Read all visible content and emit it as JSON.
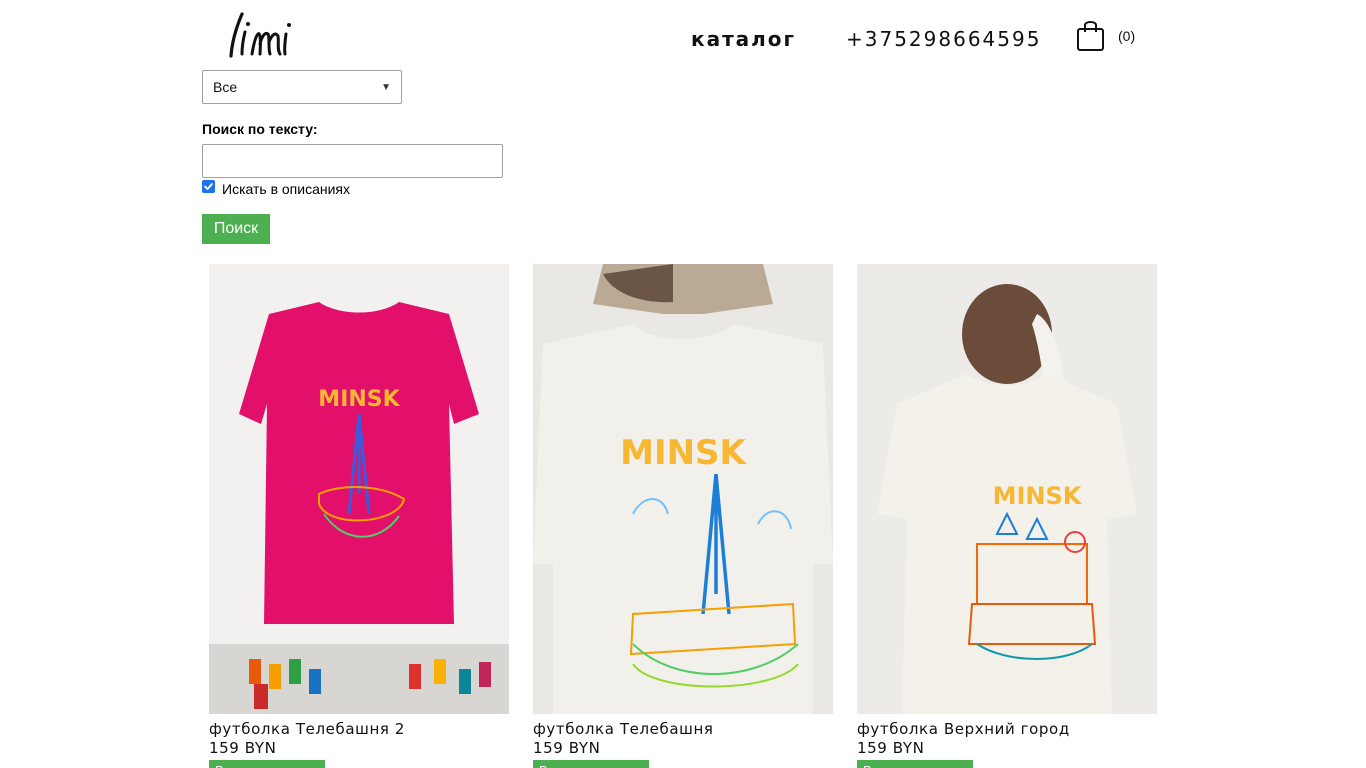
{
  "header": {
    "logo_text": "limi",
    "nav_catalog": "каталог",
    "phone": "+375298664595",
    "cart_count": "(0)"
  },
  "filter": {
    "category_selected": "Все",
    "search_label": "Поиск по тексту:",
    "search_value": "",
    "search_in_descriptions_label": "Искать в описаниях",
    "search_in_descriptions_checked": true,
    "search_button": "Поиск"
  },
  "products": [
    {
      "name": "футболка Телебашня 2",
      "price": "159 BYN",
      "button": "В корзину",
      "shirt_color": "#e3106b",
      "print_text": "MINSK"
    },
    {
      "name": "футболка Телебашня",
      "price": "159 BYN",
      "button": "В корзину",
      "shirt_color": "#f2f0ea",
      "print_text": "MINSK"
    },
    {
      "name": "футболка Верхний город",
      "price": "159 BYN",
      "button": "В корзину",
      "shirt_color": "#f3f1ea",
      "print_text": "MINSK"
    }
  ],
  "colors": {
    "accent_green": "#4caf50",
    "checkbox_blue": "#1a73e8"
  }
}
